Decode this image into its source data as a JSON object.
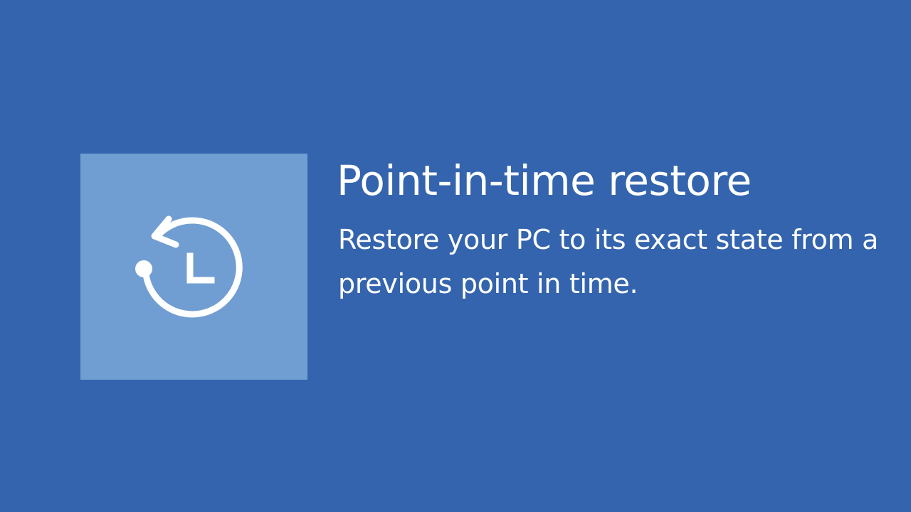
{
  "option": {
    "title": "Point-in-time restore",
    "description": "Restore your PC to its exact state from a previous point in time.",
    "icon": "history-clock-icon"
  },
  "colors": {
    "background": "#3464ad",
    "icon_tile": "#709ed2",
    "text": "#ffffff"
  }
}
